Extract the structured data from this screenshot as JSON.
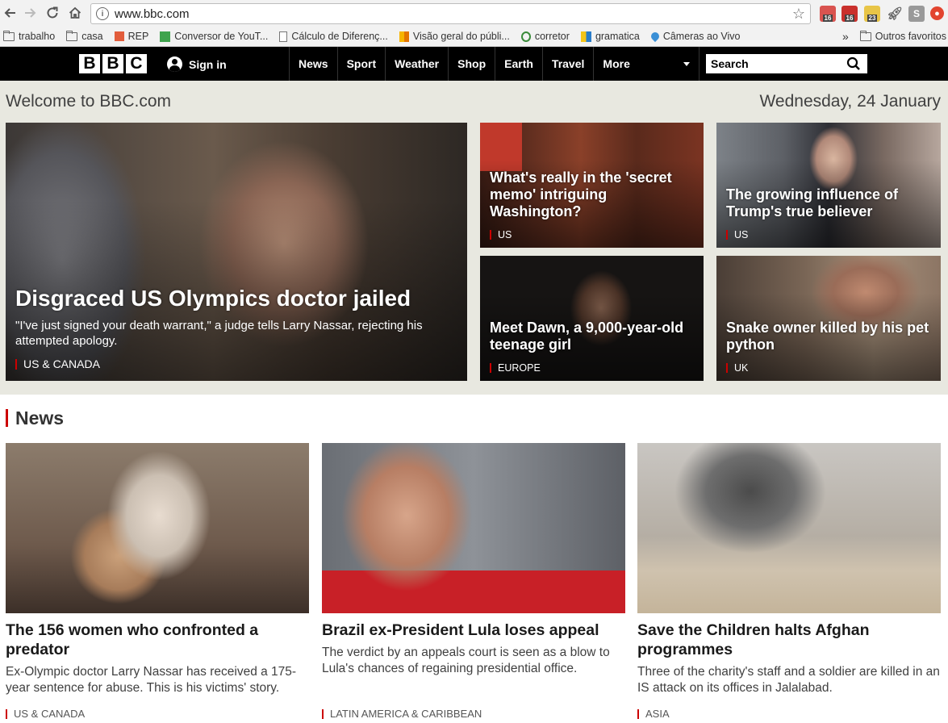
{
  "browser": {
    "url": "www.bbc.com",
    "extension_badges": [
      "16",
      "16",
      "23"
    ],
    "bookmarks": [
      {
        "label": "trabalho",
        "icon": "folder-icon"
      },
      {
        "label": "casa",
        "icon": "folder-icon"
      },
      {
        "label": "REP",
        "icon": "rep-icon"
      },
      {
        "label": "Conversor de YouT...",
        "icon": "converter-icon"
      },
      {
        "label": "Cálculo de Diferenç...",
        "icon": "page-icon"
      },
      {
        "label": "Visão geral do públi...",
        "icon": "analytics-icon"
      },
      {
        "label": "corretor",
        "icon": "corretor-icon"
      },
      {
        "label": "gramatica",
        "icon": "gramatica-icon"
      },
      {
        "label": "Câmeras ao Vivo",
        "icon": "map-pin-icon"
      }
    ],
    "bookmarks_overflow": "»",
    "other_bookmarks": "Outros favoritos"
  },
  "header": {
    "logo_letters": [
      "B",
      "B",
      "C"
    ],
    "sign_in": "Sign in",
    "nav": [
      "News",
      "Sport",
      "Weather",
      "Shop",
      "Earth",
      "Travel"
    ],
    "more": "More",
    "search_placeholder": "Search"
  },
  "welcome": {
    "title": "Welcome to BBC.com",
    "date": "Wednesday, 24 January"
  },
  "top_stories": [
    {
      "headline": "Disgraced US Olympics doctor jailed",
      "summary": "\"I've just signed your death warrant,\" a judge tells Larry Nassar, rejecting his attempted apology.",
      "tag": "US & CANADA"
    },
    {
      "headline": "What's really in the 'secret memo' intriguing Washington?",
      "tag": "US"
    },
    {
      "headline": "The growing influence of Trump's true believer",
      "tag": "US"
    },
    {
      "headline": "Meet Dawn, a 9,000-year-old teenage girl",
      "tag": "EUROPE"
    },
    {
      "headline": "Snake owner killed by his pet python",
      "tag": "UK"
    }
  ],
  "news": {
    "heading": "News",
    "stories": [
      {
        "headline": "The 156 women who confronted a predator",
        "summary": "Ex-Olympic doctor Larry Nassar has received a 175-year sentence for abuse. This is his victims' story.",
        "tag": "US & CANADA"
      },
      {
        "headline": "Brazil ex-President Lula loses appeal",
        "summary": "The verdict by an appeals court is seen as a blow to Lula's chances of regaining presidential office.",
        "tag": "LATIN AMERICA & CARIBBEAN"
      },
      {
        "headline": "Save the Children halts Afghan programmes",
        "summary": "Three of the charity's staff and a soldier are killed in an IS attack on its offices in Jalalabad.",
        "tag": "ASIA"
      }
    ]
  }
}
